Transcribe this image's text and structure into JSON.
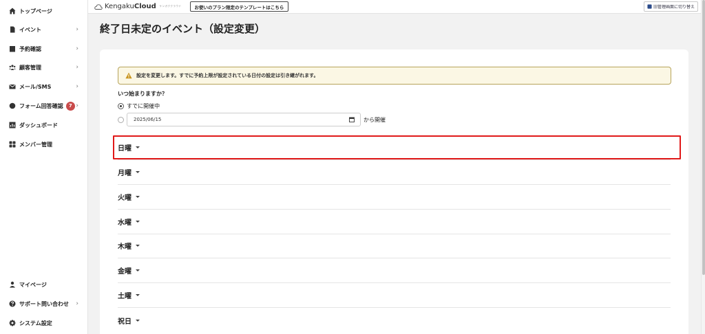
{
  "sidebar": {
    "top_items": [
      {
        "label": "トップページ",
        "icon": "home-icon",
        "chevron": false
      },
      {
        "label": "イベント",
        "icon": "document-icon",
        "chevron": true
      },
      {
        "label": "予約確認",
        "icon": "calendar-icon",
        "chevron": true
      },
      {
        "label": "顧客管理",
        "icon": "people-icon",
        "chevron": true
      },
      {
        "label": "メール/SMS",
        "icon": "mail-icon",
        "chevron": true
      },
      {
        "label": "フォーム回答確認",
        "icon": "chat-icon",
        "chevron": true,
        "badge": "7"
      },
      {
        "label": "ダッシュボード",
        "icon": "chart-icon",
        "chevron": false
      },
      {
        "label": "メンバー管理",
        "icon": "grid-icon",
        "chevron": false
      }
    ],
    "bottom_items": [
      {
        "label": "マイページ",
        "icon": "user-icon",
        "chevron": false
      },
      {
        "label": "サポート問い合わせ",
        "icon": "question-icon",
        "chevron": true
      },
      {
        "label": "システム設定",
        "icon": "gear-icon",
        "chevron": false
      }
    ]
  },
  "topbar": {
    "logo_text_light": "Kengaku",
    "logo_text_bold": "Cloud",
    "logo_tagline": "ケンガククラウド",
    "template_button": "お使いのプラン限定のテンプレートはこちら",
    "switch_button": "旧管理画面に切り替え"
  },
  "page": {
    "title": "終了日未定のイベント（設定変更）"
  },
  "form": {
    "warning": "設定を変更します。すでに予約上限が設定されている日付の設定は引き継がれます。",
    "start_question": "いつ始まりますか？",
    "option_now": "すでに開催中",
    "date_value": "2025/06/15",
    "from_label": "から開催",
    "days": [
      "日曜",
      "月曜",
      "火曜",
      "水曜",
      "木曜",
      "金曜",
      "土曜",
      "祝日"
    ]
  },
  "colors": {
    "highlight": "#e01818",
    "badge": "#c94b4b",
    "warning_bg": "#fbf7e4",
    "warning_border": "#b6a35a"
  }
}
